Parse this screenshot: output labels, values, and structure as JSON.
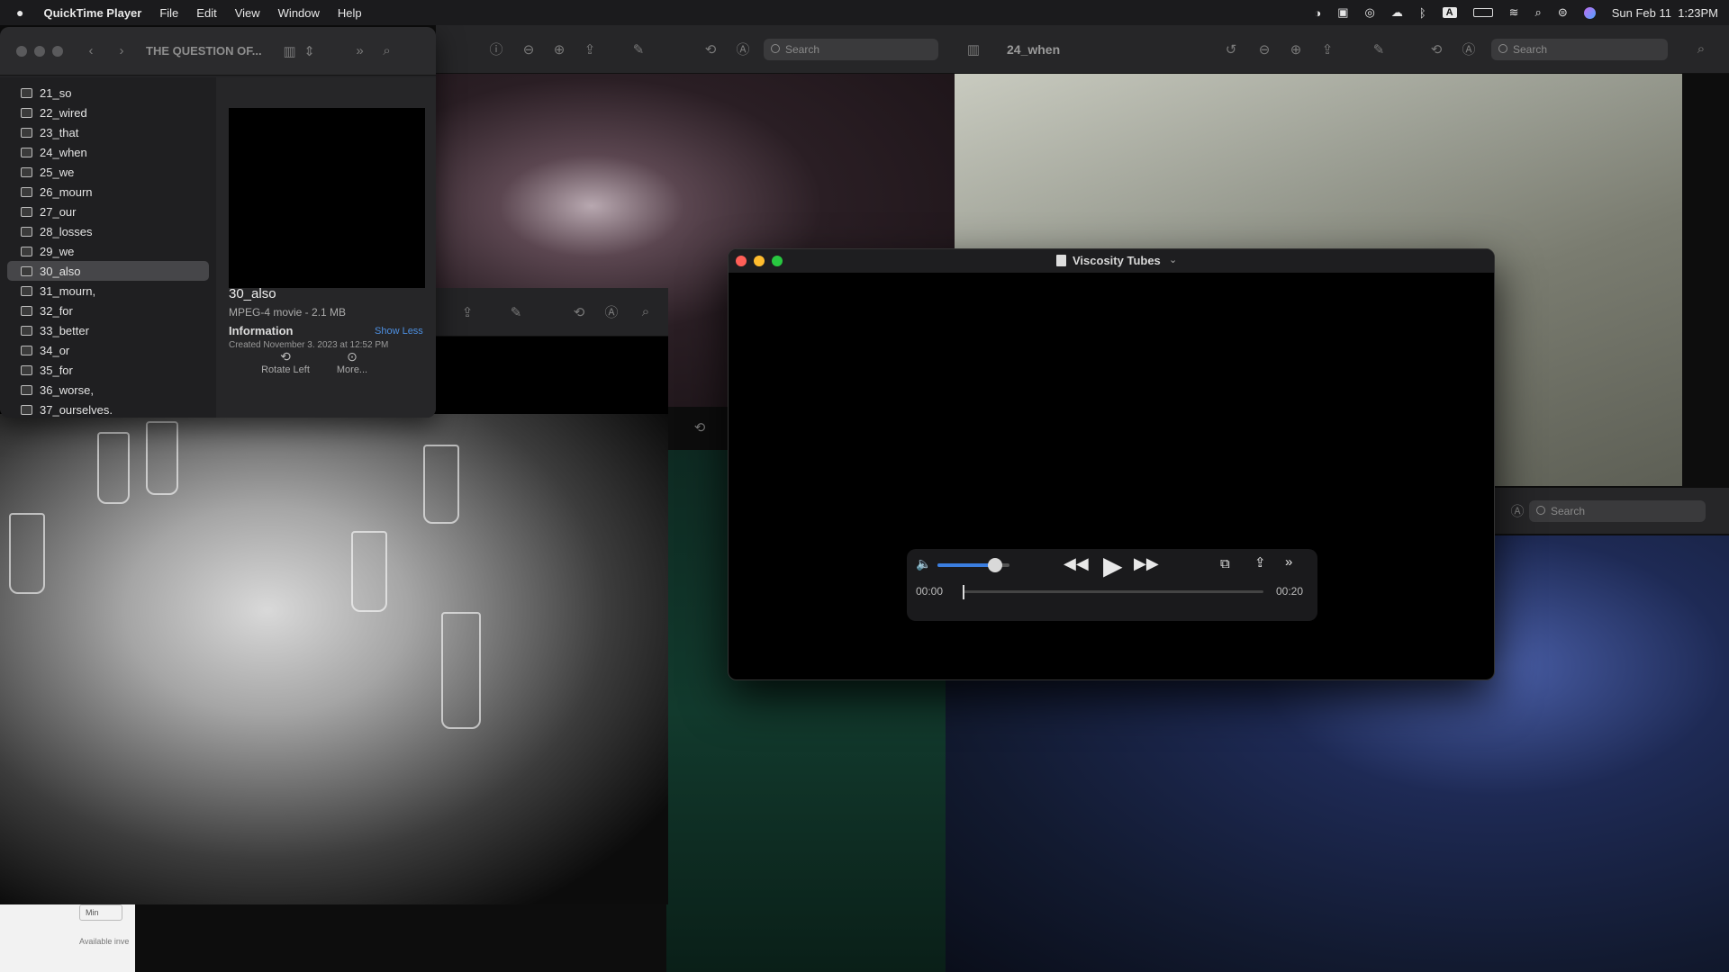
{
  "menubar": {
    "app": "QuickTime Player",
    "menus": [
      "File",
      "Edit",
      "View",
      "Window",
      "Help"
    ],
    "datetime": "Sun Feb 11  1:23PM",
    "keyboard_label": "A"
  },
  "finder": {
    "title": "THE QUESTION OF...",
    "files": [
      "21_so",
      "22_wired",
      "23_that",
      "24_when",
      "25_we",
      "26_mourn",
      "27_our",
      "28_losses",
      "29_we",
      "30_also",
      "31_mourn,",
      "32_for",
      "33_better",
      "34_or",
      "35_for",
      "36_worse,",
      "37_ourselves."
    ],
    "selected_index": 9,
    "preview": {
      "name": "30_also",
      "kind": "MPEG-4 movie - 2.1 MB",
      "info_label": "Information",
      "show_less": "Show Less",
      "created_partial": "Created   November 3, 2023 at 12:52 PM",
      "rotate_label": "Rotate Left",
      "more_label": "More..."
    }
  },
  "preview_window_right": {
    "title": "24_when",
    "search_placeholder": "Search"
  },
  "preview_window_left": {
    "search_placeholder": "Search"
  },
  "preview_window_bottom_right": {
    "search_placeholder": "Search"
  },
  "quicktime": {
    "title": "Viscosity Tubes",
    "current_time": "00:00",
    "duration": "00:20",
    "volume_level": 0.8,
    "progress": 0.0
  },
  "bottom_left_fragment": {
    "min_label": "Min",
    "available_label": "Available inve"
  }
}
